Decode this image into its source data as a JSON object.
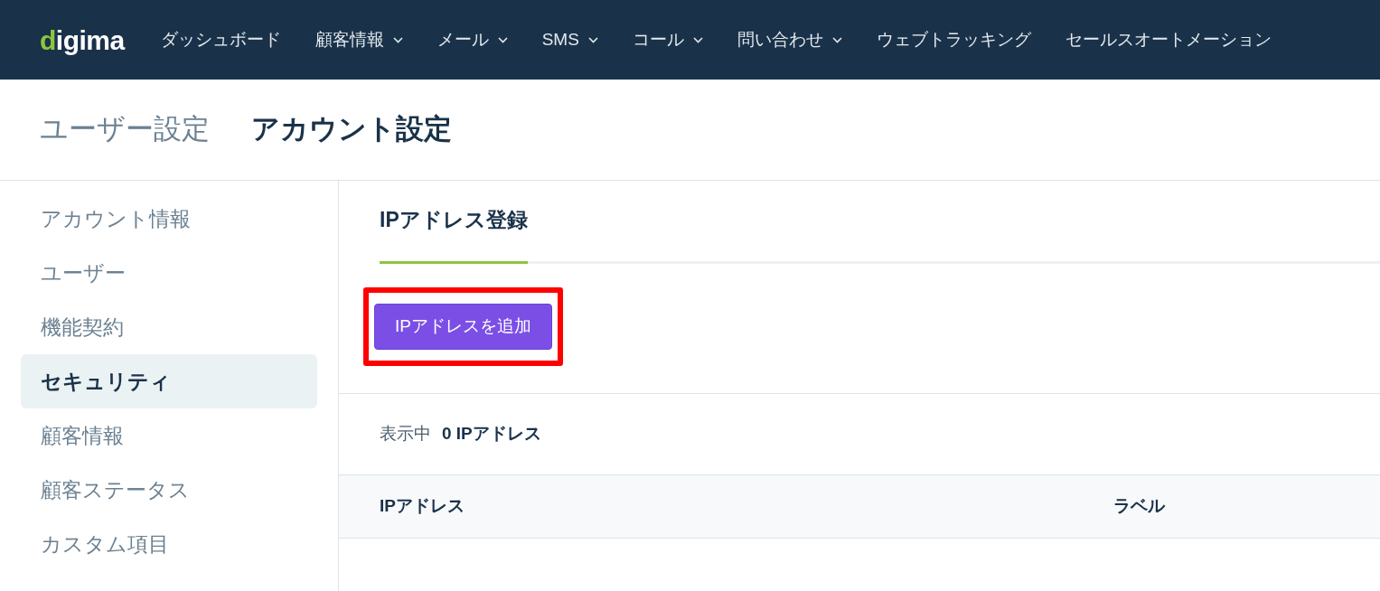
{
  "logo": "digima",
  "nav": [
    {
      "label": "ダッシュボード",
      "dropdown": false
    },
    {
      "label": "顧客情報",
      "dropdown": true
    },
    {
      "label": "メール",
      "dropdown": true
    },
    {
      "label": "SMS",
      "dropdown": true
    },
    {
      "label": "コール",
      "dropdown": true
    },
    {
      "label": "問い合わせ",
      "dropdown": true
    },
    {
      "label": "ウェブトラッキング",
      "dropdown": false
    },
    {
      "label": "セールスオートメーション",
      "dropdown": false
    }
  ],
  "breadcrumb": [
    {
      "label": "ユーザー設定",
      "selected": false
    },
    {
      "label": "アカウント設定",
      "selected": true
    }
  ],
  "sidebar": {
    "items": [
      {
        "label": "アカウント情報",
        "selected": false
      },
      {
        "label": "ユーザー",
        "selected": false
      },
      {
        "label": "機能契約",
        "selected": false
      },
      {
        "label": "セキュリティ",
        "selected": true
      },
      {
        "label": "顧客情報",
        "selected": false
      },
      {
        "label": "顧客ステータス",
        "selected": false
      },
      {
        "label": "カスタム項目",
        "selected": false
      }
    ]
  },
  "tabs": [
    {
      "label": "IPアドレス登録",
      "selected": true
    }
  ],
  "add_button": {
    "label": "IPアドレスを追加",
    "highlighted": true
  },
  "count": {
    "label": "表示中",
    "value": "0 IPアドレス"
  },
  "table": {
    "columns": [
      "IPアドレス",
      "ラベル"
    ]
  }
}
